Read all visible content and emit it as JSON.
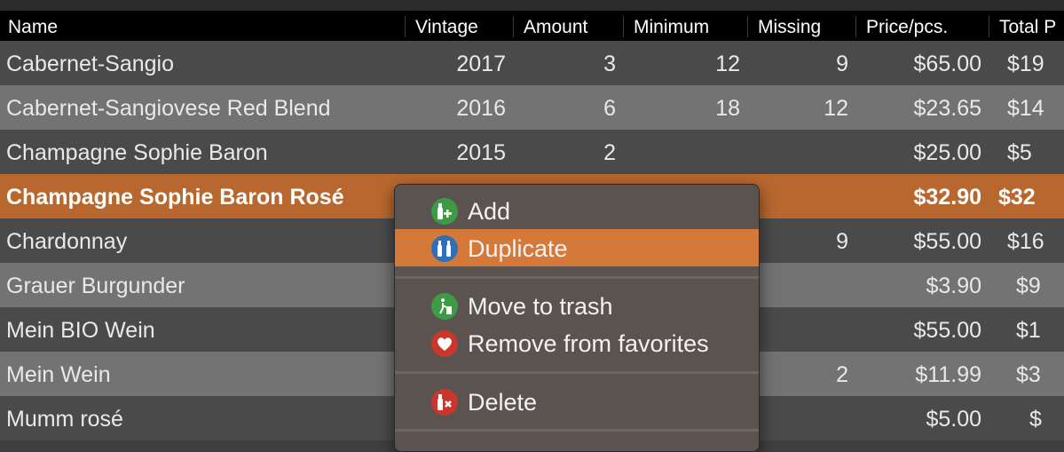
{
  "columns": [
    "Name",
    "Vintage",
    "Amount",
    "Minimum",
    "Missing",
    "Price/pcs.",
    "Total P"
  ],
  "rows": [
    {
      "name": "Cabernet-Sangio",
      "vintage": "2017",
      "amount": "3",
      "minimum": "12",
      "missing": "9",
      "price": "$65.00",
      "total": "$19"
    },
    {
      "name": "Cabernet-Sangiovese Red Blend",
      "vintage": "2016",
      "amount": "6",
      "minimum": "18",
      "missing": "12",
      "price": "$23.65",
      "total": "$14"
    },
    {
      "name": "Champagne Sophie Baron",
      "vintage": "2015",
      "amount": "2",
      "minimum": "",
      "missing": "",
      "price": "$25.00",
      "total": "$5"
    },
    {
      "name": "Champagne Sophie Baron Rosé",
      "vintage": "",
      "amount": "",
      "minimum": "",
      "missing": "",
      "price": "$32.90",
      "total": "$32"
    },
    {
      "name": "Chardonnay",
      "vintage": "",
      "amount": "",
      "minimum": "",
      "missing": "9",
      "price": "$55.00",
      "total": "$16"
    },
    {
      "name": "Grauer Burgunder",
      "vintage": "",
      "amount": "",
      "minimum": "",
      "missing": "",
      "price": "$3.90",
      "total": "$9"
    },
    {
      "name": "Mein BIO Wein",
      "vintage": "",
      "amount": "",
      "minimum": "",
      "missing": "",
      "price": "$55.00",
      "total": "$1"
    },
    {
      "name": "Mein Wein",
      "vintage": "",
      "amount": "",
      "minimum": "",
      "missing": "2",
      "price": "$11.99",
      "total": "$3"
    },
    {
      "name": "Mumm rosé",
      "vintage": "",
      "amount": "",
      "minimum": "",
      "missing": "",
      "price": "$5.00",
      "total": "$"
    }
  ],
  "selected_row_index": 3,
  "context_menu": {
    "items": [
      {
        "label": "Add",
        "icon": "bottle-add-icon",
        "color": "#3f9a45"
      },
      {
        "label": "Duplicate",
        "icon": "bottles-duplicate-icon",
        "color": "#2f6fb8",
        "highlighted": true
      },
      {
        "label": "Move to trash",
        "icon": "trash-icon",
        "color": "#3f9a45"
      },
      {
        "label": "Remove from favorites",
        "icon": "heart-icon",
        "color": "#c9362b"
      },
      {
        "label": "Delete",
        "icon": "bottle-delete-icon",
        "color": "#c9362b"
      }
    ]
  },
  "colors": {
    "header_bg": "#000000",
    "row_dark": "#4a4a4a",
    "row_light": "#737373",
    "selected_row": "#b8682e",
    "menu_highlight": "#d5793b"
  }
}
